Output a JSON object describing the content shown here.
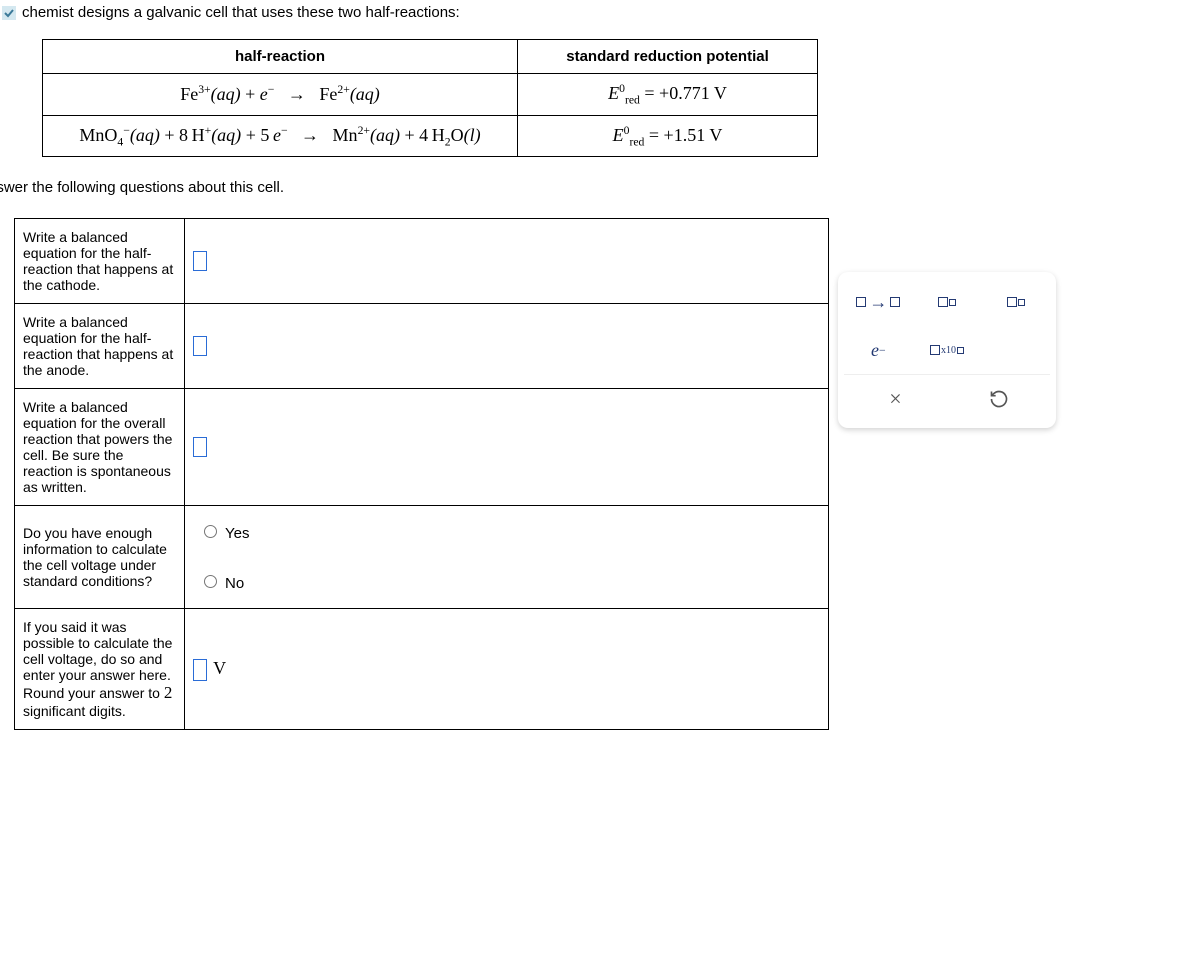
{
  "prompt": "chemist designs a galvanic cell that uses these two half-reactions:",
  "table": {
    "headers": {
      "reaction": "half-reaction",
      "potential": "standard reduction potential"
    },
    "rows": [
      {
        "species": {
          "lhs_a": "Fe",
          "lhs_a_sup": "3+",
          "lhs_a_state": "(aq)",
          "plus": "+",
          "e": "e",
          "e_sup": "−",
          "arrow": "→",
          "rhs_a": "Fe",
          "rhs_a_sup": "2+",
          "rhs_a_state": "(aq)"
        },
        "potential": {
          "sym": "E",
          "sup": "0",
          "sub": "red",
          "eq": "=",
          "val": "+0.771 V"
        }
      },
      {
        "species": {
          "lhs_a": "MnO",
          "lhs_a_sub": "4",
          "lhs_a_sup": "−",
          "lhs_a_state": "(aq)",
          "plus1": "+",
          "coef2": "8",
          "h": "H",
          "h_sup": "+",
          "h_state": "(aq)",
          "plus2": "+",
          "coef3": "5",
          "e": "e",
          "e_sup": "−",
          "arrow": "→",
          "rhs_a": "Mn",
          "rhs_a_sup": "2+",
          "rhs_a_state": "(aq)",
          "plus3": "+",
          "coef4": "4",
          "w": "H",
          "w_sub": "2",
          "w2": "O",
          "w_state": "(l)"
        },
        "potential": {
          "sym": "E",
          "sup": "0",
          "sub": "red",
          "eq": "=",
          "val": "+1.51 V"
        }
      }
    ]
  },
  "followup": "Answer the following questions about this cell.",
  "questions": {
    "cathode": "Write a balanced equation for the half-reaction that happens at the cathode.",
    "anode": "Write a balanced equation for the half-reaction that happens at the anode.",
    "overall": "Write a balanced equation for the overall reaction that powers the cell. Be sure the reaction is spontaneous as written.",
    "enough": "Do you have enough information to calculate the cell voltage under standard conditions?",
    "yes": "Yes",
    "no": "No",
    "voltage_q_a": "If you said it was possible to calculate the cell voltage, do so and enter your answer here. Round your answer to ",
    "voltage_q_digits": "2",
    "voltage_q_b": " significant digits.",
    "volt_unit": "V"
  },
  "toolbox": {
    "arrow_tip": "□→□",
    "subscript_tip": "□□",
    "superscript_tip": "□□",
    "electron": "e",
    "electron_sup": "−",
    "times10": "x10",
    "clear": "×",
    "reset": "↺"
  }
}
